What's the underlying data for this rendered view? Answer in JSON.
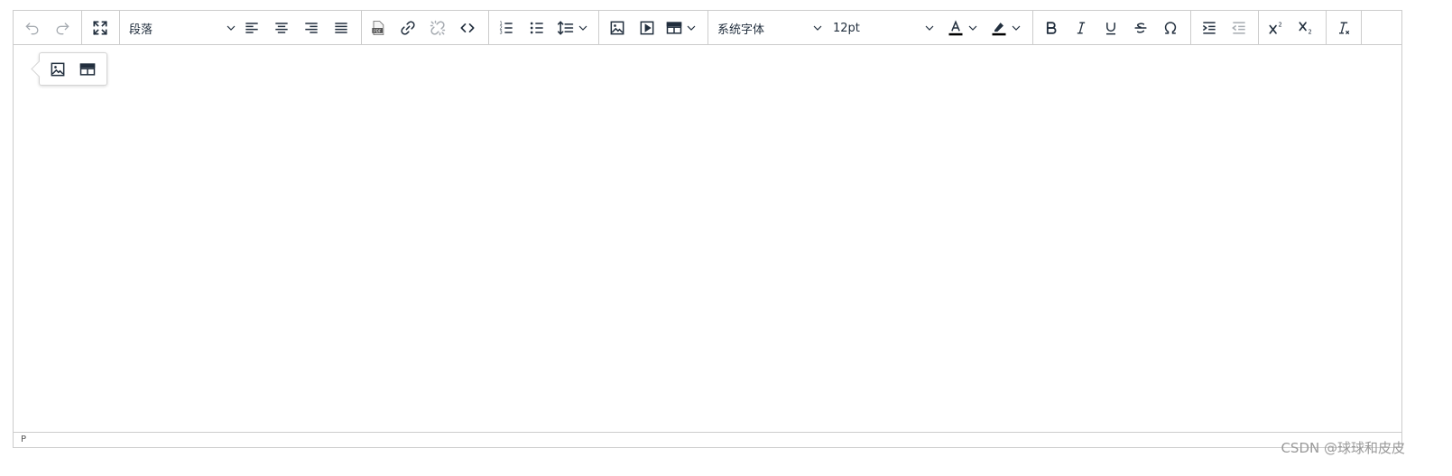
{
  "toolbar": {
    "block_format": {
      "selected": "段落"
    },
    "font_family": {
      "selected": "系统字体"
    },
    "font_size": {
      "selected": "12pt"
    },
    "text_color": "#000000",
    "highlight_color": "#000000",
    "icons": [
      "undo-icon",
      "redo-icon",
      "fullscreen-icon",
      "align-left-icon",
      "align-center-icon",
      "align-right-icon",
      "align-justify-icon",
      "pdf-icon",
      "link-icon",
      "unlink-icon",
      "code-icon",
      "ordered-list-icon",
      "bullet-list-icon",
      "line-height-icon",
      "image-icon",
      "media-icon",
      "table-icon",
      "text-color-icon",
      "highlight-icon",
      "bold-icon",
      "italic-icon",
      "underline-icon",
      "strikethrough-icon",
      "special-char-icon",
      "indent-icon",
      "outdent-icon",
      "superscript-icon",
      "subscript-icon",
      "clear-format-icon"
    ]
  },
  "statusbar": {
    "path": "P"
  },
  "watermark": {
    "text": "CSDN @球球和皮皮"
  }
}
